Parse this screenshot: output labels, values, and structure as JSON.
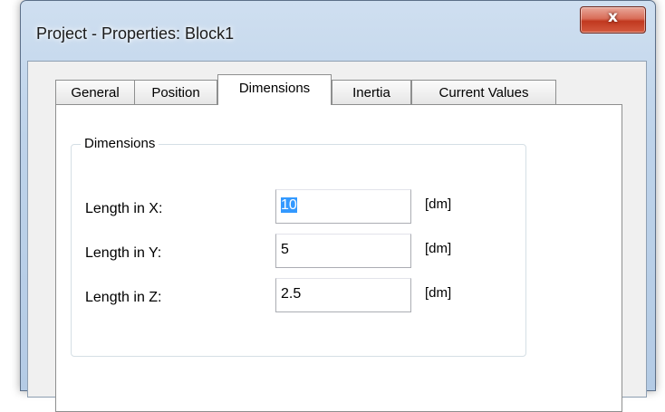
{
  "window": {
    "title": "Project - Properties: Block1",
    "close_glyph": "x"
  },
  "tabs": [
    {
      "label": "General",
      "active": false
    },
    {
      "label": "Position",
      "active": false
    },
    {
      "label": "Dimensions",
      "active": true
    },
    {
      "label": "Inertia",
      "active": false
    },
    {
      "label": "Current Values",
      "active": false
    }
  ],
  "dimensions_group": {
    "legend": "Dimensions",
    "fields": [
      {
        "label": "Length in X:",
        "value": "10",
        "unit": "[dm]",
        "selected": true
      },
      {
        "label": "Length in Y:",
        "value": "5",
        "unit": "[dm]",
        "selected": false
      },
      {
        "label": "Length in Z:",
        "value": "2.5",
        "unit": "[dm]",
        "selected": false
      }
    ]
  },
  "colors": {
    "selection": "#3399ff",
    "close_button": "#c0381f",
    "frame": "#bed3ea"
  }
}
